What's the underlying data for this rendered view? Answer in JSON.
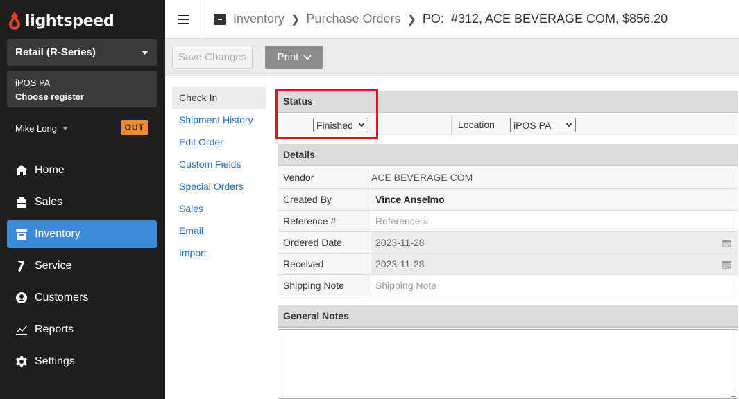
{
  "brand": {
    "name": "lightspeed",
    "accent": "#e83f2f"
  },
  "sidebar": {
    "account": "Retail (R-Series)",
    "shop": "iPOS PA",
    "register_link": "Choose register",
    "user": "Mike Long",
    "status_badge": "OUT",
    "nav": [
      {
        "label": "Home",
        "icon": "home-icon"
      },
      {
        "label": "Sales",
        "icon": "register-icon"
      },
      {
        "label": "Inventory",
        "icon": "inventory-icon",
        "active": true
      },
      {
        "label": "Service",
        "icon": "hammer-icon"
      },
      {
        "label": "Customers",
        "icon": "user-circle-icon"
      },
      {
        "label": "Reports",
        "icon": "chart-icon"
      },
      {
        "label": "Settings",
        "icon": "gear-icon"
      }
    ]
  },
  "header": {
    "breadcrumb": [
      "Inventory",
      "Purchase Orders"
    ],
    "current": "PO:  #312, ACE BEVERAGE COM, $856.20"
  },
  "toolbar": {
    "save_label": "Save Changes",
    "print_label": "Print"
  },
  "submenu": [
    "Check In",
    "Shipment History",
    "Edit Order",
    "Custom Fields",
    "Special Orders",
    "Sales",
    "Email",
    "Import"
  ],
  "status": {
    "heading": "Status",
    "value": "Finished",
    "location_label": "Location",
    "location_value": "iPOS PA"
  },
  "details": {
    "heading": "Details",
    "vendor_label": "Vendor",
    "vendor_value": "ACE BEVERAGE COM",
    "created_label": "Created By",
    "created_value": "Vince Anselmo",
    "reference_label": "Reference #",
    "reference_placeholder": "Reference #",
    "ordered_label": "Ordered Date",
    "ordered_value": "2023-11-28",
    "received_label": "Received",
    "received_value": "2023-11-28",
    "shipping_label": "Shipping Note",
    "shipping_placeholder": "Shipping Note"
  },
  "notes": {
    "heading": "General Notes",
    "value": ""
  },
  "colors": {
    "sidebar_bg": "#1e1e1e",
    "nav_active": "#3d8ad9",
    "badge": "#f28b30",
    "link": "#2a6eb8",
    "highlight": "#e0131a"
  }
}
